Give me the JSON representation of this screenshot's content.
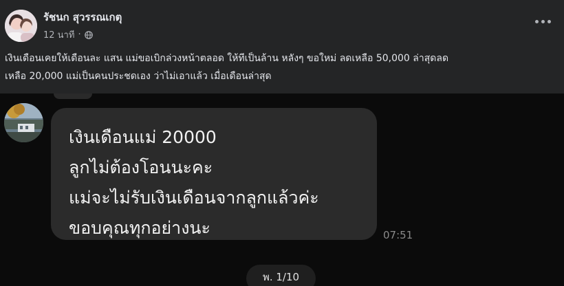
{
  "post": {
    "author": "รัชนก สุวรรณเกตุ",
    "time": "12 นาที",
    "separator": "·",
    "privacy_icon": "globe-icon",
    "more_icon": "more-options-icon",
    "text_lines": [
      "เงินเดือนเคยให้เดือนละ แสน แม่ขอเบิกล่วงหน้าตลอด ให้ทีเป็นล้าน  หลังๆ ขอใหม่ ลดเหลือ 50,000 ล่าสุดลด",
      "เหลือ 20,000 แม่เป็นคนประชดเอง ว่าไม่เอาแล้ว เมื่อเดือนล่าสุด"
    ]
  },
  "chat": {
    "message_lines": [
      "เงินเดือนแม่ 20000",
      "ลูกไม่ต้องโอนนะคะ",
      "แม่จะไม่รับเงินเดือนจากลูกแล้วค่ะ",
      "ขอบคุณทุกอย่างนะ"
    ],
    "time": "07:51",
    "pager": "พ. 1/10"
  },
  "colors": {
    "post_background": "#242526",
    "chat_background": "#0b0b0b",
    "bubble": "#2b2b2b",
    "primary_text": "#e4e6eb",
    "secondary_text": "#b0b3b8"
  }
}
